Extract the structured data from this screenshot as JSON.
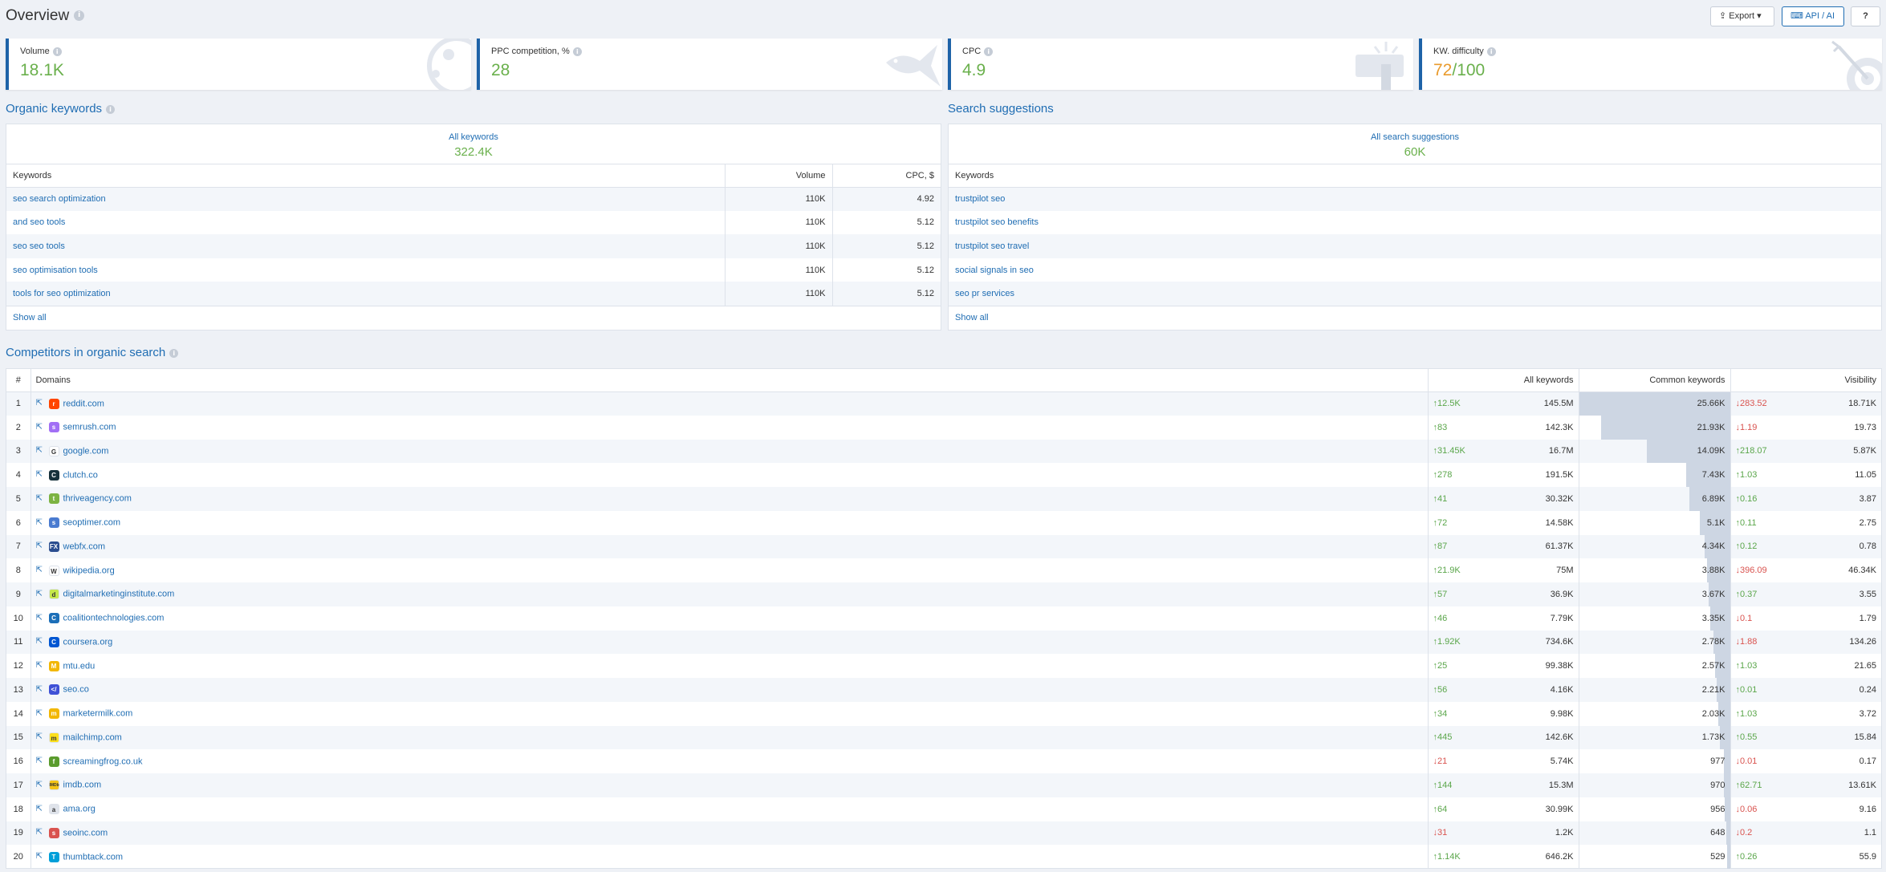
{
  "header": {
    "title": "Overview",
    "export_label": "Export",
    "api_label": "API / AI",
    "help_label": "?"
  },
  "cards": [
    {
      "label": "Volume",
      "value": "18.1K",
      "icon": "chart-icon"
    },
    {
      "label": "PPC competition, %",
      "value": "28",
      "icon": "fish-icon"
    },
    {
      "label": "CPC",
      "value": "4.9",
      "icon": "cursor-icon"
    },
    {
      "label": "KW. difficulty",
      "value": "72",
      "value_total": "/100",
      "icon": "target-icon"
    }
  ],
  "organic": {
    "title": "Organic keywords",
    "summary_label": "All keywords",
    "summary_value": "322.4K",
    "columns": [
      "Keywords",
      "Volume",
      "CPC, $"
    ],
    "rows": [
      {
        "keyword": "seo search optimization",
        "volume": "110K",
        "cpc": "4.92"
      },
      {
        "keyword": "and seo tools",
        "volume": "110K",
        "cpc": "5.12"
      },
      {
        "keyword": "seo seo tools",
        "volume": "110K",
        "cpc": "5.12"
      },
      {
        "keyword": "seo optimisation tools",
        "volume": "110K",
        "cpc": "5.12"
      },
      {
        "keyword": "tools for seo optimization",
        "volume": "110K",
        "cpc": "5.12"
      }
    ],
    "show_all": "Show all"
  },
  "suggestions": {
    "title": "Search suggestions",
    "summary_label": "All search suggestions",
    "summary_value": "60K",
    "columns": [
      "Keywords"
    ],
    "rows": [
      "trustpilot seo",
      "trustpilot seo benefits",
      "trustpilot seo travel",
      "social signals in seo",
      "seo pr services"
    ],
    "show_all": "Show all"
  },
  "competitors": {
    "title": "Competitors in organic search",
    "columns": [
      "#",
      "Domains",
      "All keywords",
      "Common keywords",
      "Visibility"
    ],
    "rows": [
      {
        "n": "1",
        "domain": "reddit.com",
        "fav_color": "#ff4500",
        "fav": "r",
        "ak_dir": "up",
        "ak_change": "12.5K",
        "all_kw": "145.5M",
        "common": "25.66K",
        "common_share": 1.0,
        "v_dir": "dn",
        "v_change": "283.52",
        "visibility": "18.71K"
      },
      {
        "n": "2",
        "domain": "semrush.com",
        "fav_color": "#a16ff5",
        "fav": "s",
        "ak_dir": "up",
        "ak_change": "83",
        "all_kw": "142.3K",
        "common": "21.93K",
        "common_share": 0.855,
        "v_dir": "dn",
        "v_change": "1.19",
        "visibility": "19.73"
      },
      {
        "n": "3",
        "domain": "google.com",
        "fav_color": "#ffffff",
        "fav": "G",
        "ak_dir": "up",
        "ak_change": "31.45K",
        "all_kw": "16.7M",
        "common": "14.09K",
        "common_share": 0.549,
        "v_dir": "up",
        "v_change": "218.07",
        "visibility": "5.87K"
      },
      {
        "n": "4",
        "domain": "clutch.co",
        "fav_color": "#17313b",
        "fav": "C",
        "ak_dir": "up",
        "ak_change": "278",
        "all_kw": "191.5K",
        "common": "7.43K",
        "common_share": 0.29,
        "v_dir": "up",
        "v_change": "1.03",
        "visibility": "11.05"
      },
      {
        "n": "5",
        "domain": "thriveagency.com",
        "fav_color": "#7cb342",
        "fav": "t",
        "ak_dir": "up",
        "ak_change": "41",
        "all_kw": "30.32K",
        "common": "6.89K",
        "common_share": 0.268,
        "v_dir": "up",
        "v_change": "0.16",
        "visibility": "3.87"
      },
      {
        "n": "6",
        "domain": "seoptimer.com",
        "fav_color": "#4a7bd0",
        "fav": "s",
        "ak_dir": "up",
        "ak_change": "72",
        "all_kw": "14.58K",
        "common": "5.1K",
        "common_share": 0.199,
        "v_dir": "up",
        "v_change": "0.11",
        "visibility": "2.75"
      },
      {
        "n": "7",
        "domain": "webfx.com",
        "fav_color": "#2a4d8f",
        "fav": "FX",
        "ak_dir": "up",
        "ak_change": "87",
        "all_kw": "61.37K",
        "common": "4.34K",
        "common_share": 0.169,
        "v_dir": "up",
        "v_change": "0.12",
        "visibility": "0.78"
      },
      {
        "n": "8",
        "domain": "wikipedia.org",
        "fav_color": "#ffffff",
        "fav": "W",
        "ak_dir": "up",
        "ak_change": "21.9K",
        "all_kw": "75M",
        "common": "3.88K",
        "common_share": 0.151,
        "v_dir": "dn",
        "v_change": "396.09",
        "visibility": "46.34K"
      },
      {
        "n": "9",
        "domain": "digitalmarketinginstitute.com",
        "fav_color": "#c5e84a",
        "fav": "d",
        "ak_dir": "up",
        "ak_change": "57",
        "all_kw": "36.9K",
        "common": "3.67K",
        "common_share": 0.143,
        "v_dir": "up",
        "v_change": "0.37",
        "visibility": "3.55"
      },
      {
        "n": "10",
        "domain": "coalitiontechnologies.com",
        "fav_color": "#1c6fb8",
        "fav": "C",
        "ak_dir": "up",
        "ak_change": "46",
        "all_kw": "7.79K",
        "common": "3.35K",
        "common_share": 0.131,
        "v_dir": "dn",
        "v_change": "0.1",
        "visibility": "1.79"
      },
      {
        "n": "11",
        "domain": "coursera.org",
        "fav_color": "#0056d2",
        "fav": "C",
        "ak_dir": "up",
        "ak_change": "1.92K",
        "all_kw": "734.6K",
        "common": "2.78K",
        "common_share": 0.108,
        "v_dir": "dn",
        "v_change": "1.88",
        "visibility": "134.26"
      },
      {
        "n": "12",
        "domain": "mtu.edu",
        "fav_color": "#f2b705",
        "fav": "M",
        "ak_dir": "up",
        "ak_change": "25",
        "all_kw": "99.38K",
        "common": "2.57K",
        "common_share": 0.1,
        "v_dir": "up",
        "v_change": "1.03",
        "visibility": "21.65"
      },
      {
        "n": "13",
        "domain": "seo.co",
        "fav_color": "#3f51d6",
        "fav": "</",
        "ak_dir": "up",
        "ak_change": "56",
        "all_kw": "4.16K",
        "common": "2.21K",
        "common_share": 0.086,
        "v_dir": "up",
        "v_change": "0.01",
        "visibility": "0.24"
      },
      {
        "n": "14",
        "domain": "marketermilk.com",
        "fav_color": "#f2b705",
        "fav": "m",
        "ak_dir": "up",
        "ak_change": "34",
        "all_kw": "9.98K",
        "common": "2.03K",
        "common_share": 0.079,
        "v_dir": "up",
        "v_change": "1.03",
        "visibility": "3.72"
      },
      {
        "n": "15",
        "domain": "mailchimp.com",
        "fav_color": "#ffe01b",
        "fav": "m",
        "ak_dir": "up",
        "ak_change": "445",
        "all_kw": "142.6K",
        "common": "1.73K",
        "common_share": 0.067,
        "v_dir": "up",
        "v_change": "0.55",
        "visibility": "15.84"
      },
      {
        "n": "16",
        "domain": "screamingfrog.co.uk",
        "fav_color": "#5a9b2d",
        "fav": "f",
        "ak_dir": "dn",
        "ak_change": "21",
        "all_kw": "5.74K",
        "common": "977",
        "common_share": 0.038,
        "v_dir": "dn",
        "v_change": "0.01",
        "visibility": "0.17"
      },
      {
        "n": "17",
        "domain": "imdb.com",
        "fav_color": "#f5c518",
        "fav": "IMDb",
        "ak_dir": "up",
        "ak_change": "144",
        "all_kw": "15.3M",
        "common": "970",
        "common_share": 0.038,
        "v_dir": "up",
        "v_change": "62.71",
        "visibility": "13.61K"
      },
      {
        "n": "18",
        "domain": "ama.org",
        "fav_color": "#dfe3ea",
        "fav": "a",
        "ak_dir": "up",
        "ak_change": "64",
        "all_kw": "30.99K",
        "common": "956",
        "common_share": 0.037,
        "v_dir": "dn",
        "v_change": "0.06",
        "visibility": "9.16"
      },
      {
        "n": "19",
        "domain": "seoinc.com",
        "fav_color": "#d9534f",
        "fav": "s",
        "ak_dir": "dn",
        "ak_change": "31",
        "all_kw": "1.2K",
        "common": "648",
        "common_share": 0.025,
        "v_dir": "dn",
        "v_change": "0.2",
        "visibility": "1.1"
      },
      {
        "n": "20",
        "domain": "thumbtack.com",
        "fav_color": "#009fd9",
        "fav": "T",
        "ak_dir": "up",
        "ak_change": "1.14K",
        "all_kw": "646.2K",
        "common": "529",
        "common_share": 0.021,
        "v_dir": "up",
        "v_change": "0.26",
        "visibility": "55.9"
      }
    ]
  },
  "colors": {
    "accent": "#1f6db3",
    "positive": "#6ab04c",
    "negative": "#d9534f",
    "warning": "#e99b2d"
  }
}
